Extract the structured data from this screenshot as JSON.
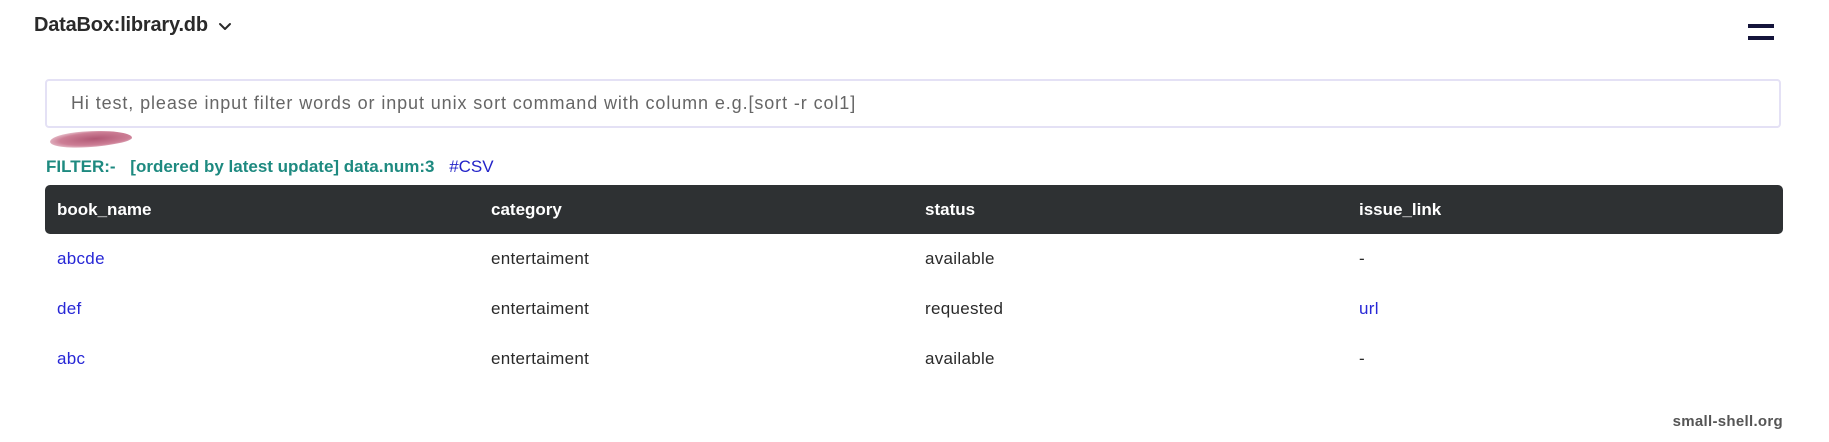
{
  "header": {
    "title": "DataBox:library.db",
    "dropdown_icon": "chevron-down-icon",
    "menu_icon": "hamburger-icon"
  },
  "search": {
    "placeholder": "Hi test, please input filter words or input unix sort command with column e.g.[sort -r col1]",
    "value": ""
  },
  "filter": {
    "label": "FILTER:-",
    "order": "[ordered by latest update] data.num:3",
    "csv_link": "#CSV"
  },
  "table": {
    "columns": [
      "book_name",
      "category",
      "status",
      "issue_link"
    ],
    "rows": [
      {
        "book_name": "abcde",
        "category": "entertaiment",
        "status": "available",
        "issue_link": "-"
      },
      {
        "book_name": "def",
        "category": "entertaiment",
        "status": "requested",
        "issue_link": "url"
      },
      {
        "book_name": "abc",
        "category": "entertaiment",
        "status": "available",
        "issue_link": "-"
      }
    ]
  },
  "footer": {
    "text": "small-shell.org"
  },
  "colors": {
    "header_bg": "#2e3133",
    "filter_text": "#1e8a80",
    "link": "#2727d6",
    "menu_icon": "#14143a"
  }
}
